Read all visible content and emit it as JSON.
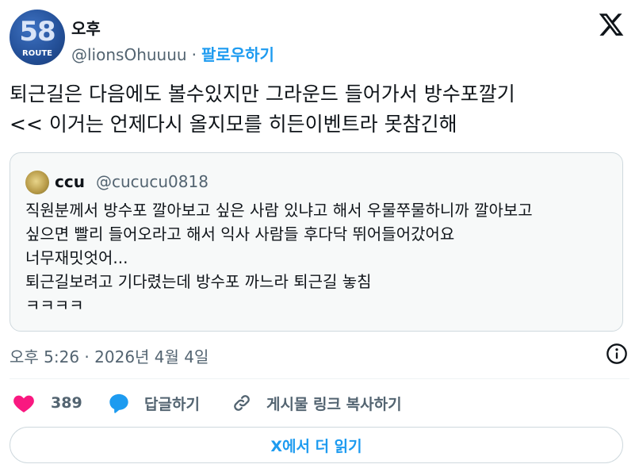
{
  "author": {
    "avatar_number": "58",
    "avatar_caption": "ROUTE",
    "display_name": "오후",
    "handle": "@lionsOhuuuu",
    "separator": "·",
    "follow_label": "팔로우하기"
  },
  "tweet": {
    "text": "퇴근길은 다음에도 볼수있지만 그라운드 들어가서 방수포깔기\n<< 이거는 언제다시 올지모를 히든이벤트라 못참긴해"
  },
  "quoted": {
    "display_name": "ccu",
    "handle": "@cucucu0818",
    "text": "직원분께서 방수포 깔아보고 싶은 사람 있냐고 해서 우물쭈물하니까 깔아보고\n싶으면 빨리 들어오라고 해서 익사 사람들 후다닥 뛰어들어갔어요\n너무재밋엇어...\n퇴근길보려고 기다렸는데 방수포 까느라 퇴근길 놓침\nㅋㅋㅋㅋ"
  },
  "meta": {
    "timestamp": "오후 5:26 · 2026년 4월 4일"
  },
  "actions": {
    "like_count": "389",
    "reply_label": "답글하기",
    "copy_link_label": "게시물 링크 복사하기"
  },
  "read_more_label": "X에서 더 읽기",
  "colors": {
    "accent": "#1d9bf0",
    "like": "#f91880",
    "text": "#0f1419",
    "secondary": "#536471",
    "border": "#cfd9de"
  },
  "icons": [
    "x-logo-icon",
    "info-icon",
    "heart-icon",
    "reply-bubble-icon",
    "link-icon"
  ]
}
